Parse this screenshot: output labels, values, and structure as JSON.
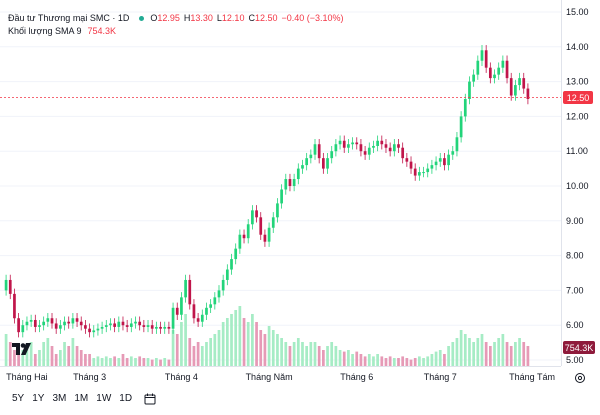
{
  "legend": {
    "symbol_title": "Đầu tư Thương mại SMC · 1D",
    "open_label": "O",
    "open": "12.95",
    "high_label": "H",
    "high": "13.30",
    "low_label": "L",
    "low": "12.10",
    "close_label": "C",
    "close": "12.50",
    "change": "−0.40 (−3.10%)",
    "volume_label": "Khối lượng SMA 9",
    "volume_value": "754.3K"
  },
  "range_buttons": [
    "5Y",
    "1Y",
    "3M",
    "1M",
    "1W",
    "1D"
  ],
  "icons": {
    "calendar": "calendar-icon",
    "settings": "gear-icon",
    "logo": "tradingview-logo"
  },
  "colors": {
    "up": "#22d47a",
    "down": "#c0154a",
    "up_vol": "#a6ecc5",
    "down_vol": "#e69ab6",
    "price_tag": "#f23645",
    "volume_tag": "#8e1a3b"
  },
  "chart_data": {
    "type": "candlestick",
    "y_axis_ticks": [
      "15.00",
      "14.00",
      "13.00",
      "12.00",
      "11.00",
      "10.00",
      "9.00",
      "8.00",
      "7.00",
      "6.00",
      "5.00"
    ],
    "ylim": [
      4.9,
      15.0
    ],
    "x_axis_ticks": [
      {
        "label": "Tháng Hai",
        "index": 0
      },
      {
        "label": "Tháng 3",
        "index": 20
      },
      {
        "label": "Tháng 4",
        "index": 42
      },
      {
        "label": "Tháng Năm",
        "index": 63
      },
      {
        "label": "Tháng 6",
        "index": 84
      },
      {
        "label": "Tháng 7",
        "index": 104
      },
      {
        "label": "Tháng Tám",
        "index": 126
      }
    ],
    "last_price_tag": "12.50",
    "volume_tag": "754.3K",
    "closes": [
      7.3,
      6.9,
      6.2,
      5.8,
      6.0,
      6.1,
      6.15,
      5.95,
      6.0,
      6.1,
      6.2,
      6.05,
      5.9,
      6.0,
      6.1,
      6.05,
      6.2,
      6.1,
      6.0,
      5.9,
      5.8,
      5.85,
      5.9,
      5.95,
      6.0,
      6.05,
      5.95,
      6.1,
      6.0,
      5.95,
      6.05,
      6.1,
      6.0,
      5.95,
      6.0,
      5.9,
      5.95,
      5.9,
      5.95,
      5.9,
      6.5,
      6.3,
      6.8,
      7.3,
      6.6,
      6.2,
      6.1,
      6.3,
      6.5,
      6.6,
      6.8,
      7.0,
      7.3,
      7.6,
      7.9,
      8.2,
      8.6,
      8.5,
      8.9,
      9.3,
      9.1,
      8.6,
      8.4,
      8.8,
      9.1,
      9.5,
      9.9,
      10.2,
      10.0,
      10.2,
      10.5,
      10.6,
      10.8,
      10.9,
      11.2,
      10.8,
      10.5,
      10.8,
      11.0,
      11.2,
      11.3,
      11.1,
      11.2,
      11.25,
      11.2,
      11.0,
      10.9,
      11.1,
      11.15,
      11.3,
      11.2,
      11.1,
      11.0,
      11.2,
      11.1,
      10.8,
      10.7,
      10.5,
      10.3,
      10.4,
      10.4,
      10.5,
      10.6,
      10.7,
      10.8,
      10.6,
      10.9,
      11.0,
      11.4,
      12.0,
      12.5,
      13.0,
      13.2,
      13.6,
      13.9,
      13.4,
      13.1,
      13.2,
      13.4,
      13.6,
      13.1,
      12.6,
      12.9,
      13.1,
      12.8,
      12.5
    ],
    "volumes": [
      0.4,
      0.3,
      0.2,
      0.15,
      0.2,
      0.25,
      0.3,
      0.15,
      0.2,
      0.3,
      0.35,
      0.25,
      0.15,
      0.2,
      0.3,
      0.25,
      0.35,
      0.25,
      0.2,
      0.15,
      0.15,
      0.1,
      0.12,
      0.1,
      0.12,
      0.1,
      0.12,
      0.1,
      0.15,
      0.1,
      0.12,
      0.1,
      0.12,
      0.1,
      0.1,
      0.08,
      0.1,
      0.08,
      0.1,
      0.08,
      0.45,
      0.4,
      0.55,
      0.65,
      0.35,
      0.25,
      0.3,
      0.25,
      0.3,
      0.35,
      0.4,
      0.45,
      0.55,
      0.6,
      0.65,
      0.7,
      0.75,
      0.6,
      0.55,
      0.65,
      0.55,
      0.45,
      0.4,
      0.5,
      0.45,
      0.4,
      0.35,
      0.3,
      0.25,
      0.3,
      0.35,
      0.3,
      0.25,
      0.3,
      0.3,
      0.25,
      0.2,
      0.25,
      0.3,
      0.25,
      0.2,
      0.18,
      0.2,
      0.15,
      0.18,
      0.15,
      0.12,
      0.15,
      0.12,
      0.15,
      0.12,
      0.1,
      0.12,
      0.1,
      0.1,
      0.12,
      0.1,
      0.08,
      0.1,
      0.12,
      0.1,
      0.12,
      0.15,
      0.18,
      0.2,
      0.15,
      0.25,
      0.3,
      0.35,
      0.45,
      0.4,
      0.35,
      0.3,
      0.35,
      0.4,
      0.3,
      0.25,
      0.3,
      0.35,
      0.4,
      0.3,
      0.25,
      0.3,
      0.35,
      0.3,
      0.25
    ]
  }
}
